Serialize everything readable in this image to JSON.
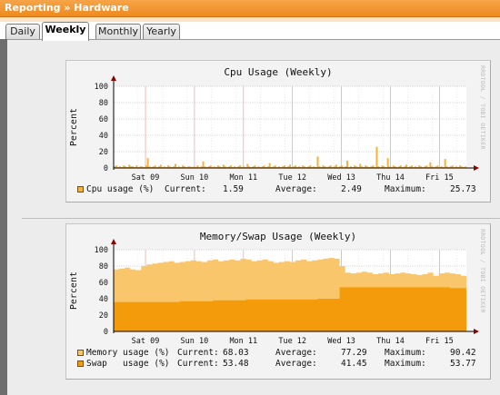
{
  "header": {
    "breadcrumb": "Reporting » Hardware"
  },
  "tabs": [
    {
      "label": "Daily",
      "active": false
    },
    {
      "label": "Weekly",
      "active": true
    },
    {
      "label": "Monthly",
      "active": false
    },
    {
      "label": "Yearly",
      "active": false
    }
  ],
  "colors": {
    "brand_orange": "#ee8a1e",
    "cpu_series": "#f7b23a",
    "memory_series": "#f9c66c",
    "swap_series": "#f49b0b",
    "grid_major": "#e8a0a0",
    "axis_arrow": "#8b0000"
  },
  "cpu_graph": {
    "watermark": "RRDTOOL / TOBI OETIKER",
    "legend": [
      {
        "name": "Cpu usage (%)",
        "current_label": "Current:",
        "current": "1.59",
        "average_label": "Average:",
        "average": "2.49",
        "maximum_label": "Maximum:",
        "maximum": "25.73",
        "color": "#f7b23a"
      }
    ]
  },
  "mem_graph": {
    "watermark": "RRDTOOL / TOBI OETIKER",
    "legend": [
      {
        "name": "Memory usage (%)",
        "current_label": "Current:",
        "current": "68.03",
        "average_label": "Average:",
        "average": "77.29",
        "maximum_label": "Maximum:",
        "maximum": "90.42",
        "color": "#f9c66c"
      },
      {
        "name": "Swap   usage (%)",
        "current_label": "Current:",
        "current": "53.48",
        "average_label": "Average:",
        "average": "41.45",
        "maximum_label": "Maximum:",
        "maximum": "53.77",
        "color": "#f49b0b"
      }
    ]
  },
  "chart_data": [
    {
      "type": "area",
      "title": "Cpu Usage (Weekly)",
      "ylabel": "Percent",
      "ylim": [
        0,
        100
      ],
      "yticks": [
        0,
        20,
        40,
        60,
        80,
        100
      ],
      "categories": [
        "Sat 09",
        "Sun 10",
        "Mon 11",
        "Tue 12",
        "Wed 13",
        "Thu 14",
        "Fri 15"
      ],
      "grid": true,
      "series": [
        {
          "name": "Cpu usage (%)",
          "values": [
            2,
            3,
            1,
            2,
            1,
            3,
            2,
            1,
            4,
            2,
            2,
            1,
            3,
            1,
            2,
            2,
            1,
            3,
            12,
            2,
            1,
            2,
            3,
            1,
            2,
            4,
            1,
            2,
            1,
            3,
            2,
            1,
            2,
            5,
            1,
            2,
            1,
            3,
            2,
            1,
            2,
            2,
            1,
            2,
            1,
            3,
            1,
            2,
            8,
            2,
            1,
            2,
            3,
            1,
            2,
            1,
            3,
            2,
            1,
            4,
            2,
            1,
            2,
            3,
            1,
            2,
            1,
            2,
            3,
            1,
            2,
            1,
            5,
            2,
            1,
            2,
            3,
            1,
            2,
            1,
            2,
            3,
            1,
            2,
            6,
            1,
            2,
            3,
            1,
            2,
            1,
            2,
            3,
            1,
            2,
            4,
            1,
            2,
            3,
            1,
            2,
            1,
            3,
            2,
            1,
            2,
            3,
            1,
            2,
            1,
            14,
            2,
            1,
            3,
            2,
            1,
            2,
            3,
            1,
            2,
            4,
            1,
            2,
            3,
            1,
            2,
            9,
            1,
            2,
            1,
            3,
            2,
            1,
            5,
            2,
            1,
            3,
            2,
            1,
            2,
            3,
            1,
            26,
            2,
            1,
            3,
            2,
            1,
            12,
            2,
            1,
            3,
            2,
            1,
            2,
            3,
            1,
            2,
            4,
            1,
            2,
            3,
            1,
            2,
            1,
            3,
            2,
            1,
            2,
            3,
            1,
            7,
            2,
            1,
            2,
            3,
            1,
            2,
            1,
            11,
            2,
            1,
            2,
            3,
            1,
            2,
            1,
            3,
            2,
            1,
            2
          ]
        }
      ]
    },
    {
      "type": "area",
      "title": "Memory/Swap Usage (Weekly)",
      "ylabel": "Percent",
      "ylim": [
        0,
        100
      ],
      "yticks": [
        0,
        20,
        40,
        60,
        80,
        100
      ],
      "categories": [
        "Sat 09",
        "Sun 10",
        "Mon 11",
        "Tue 12",
        "Wed 13",
        "Thu 14",
        "Fri 15"
      ],
      "grid": true,
      "series": [
        {
          "name": "Memory usage (%)",
          "values": [
            76,
            77,
            78,
            76,
            75,
            80,
            82,
            83,
            84,
            85,
            86,
            84,
            85,
            86,
            87,
            86,
            85,
            87,
            88,
            86,
            87,
            88,
            87,
            89,
            88,
            86,
            87,
            88,
            86,
            84,
            85,
            86,
            85,
            87,
            88,
            86,
            87,
            88,
            89,
            90,
            89,
            80,
            72,
            71,
            72,
            73,
            72,
            70,
            71,
            72,
            70,
            71,
            72,
            71,
            70,
            69,
            70,
            72,
            68,
            71,
            72,
            71,
            70,
            68
          ]
        },
        {
          "name": "Swap   usage (%)",
          "values": [
            36,
            36,
            36,
            36,
            36,
            36,
            36,
            36,
            36,
            36,
            36,
            36,
            37,
            37,
            37,
            37,
            37,
            37,
            38,
            38,
            38,
            38,
            38,
            38,
            39,
            39,
            39,
            39,
            39,
            39,
            39,
            39,
            39,
            39,
            39,
            39,
            39,
            40,
            40,
            40,
            40,
            54,
            54,
            54,
            54,
            54,
            54,
            54,
            54,
            54,
            54,
            54,
            54,
            54,
            54,
            54,
            54,
            54,
            54,
            54,
            54,
            53,
            53,
            53
          ]
        }
      ]
    }
  ]
}
